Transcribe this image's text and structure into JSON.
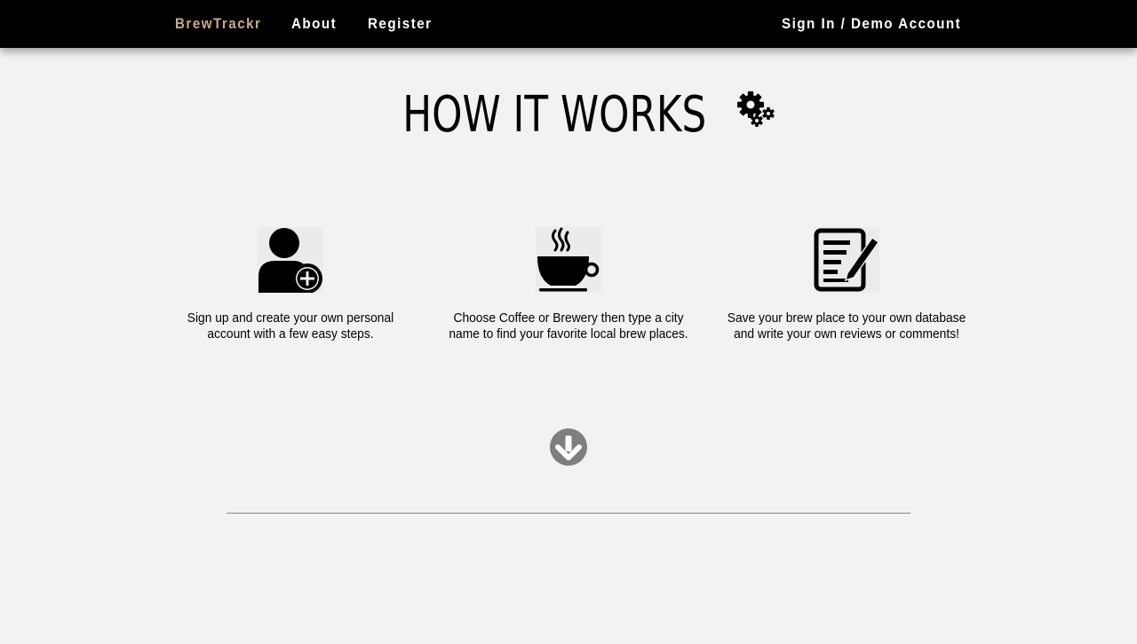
{
  "nav": {
    "brand": "BrewTrackr",
    "about": "About",
    "register": "Register",
    "signin": "Sign In / Demo Account"
  },
  "main": {
    "title": "HOW IT WORKS",
    "title_icon": "gears-icon",
    "steps": [
      {
        "icon": "user-plus-icon",
        "text": "Sign up and create your own personal account with a few easy steps."
      },
      {
        "icon": "coffee-cup-icon",
        "text": "Choose Coffee or Brewery then type a city name to find your favorite local brew places."
      },
      {
        "icon": "edit-note-icon",
        "text": "Save your brew place to your own database and write your own reviews or comments!"
      }
    ],
    "scroll_icon": "arrow-circle-down-icon"
  },
  "colors": {
    "nav_bg": "#000000",
    "brand": "#c8a98b",
    "page_bg": "#f2f2f2",
    "arrow": "#7f7f7f"
  }
}
